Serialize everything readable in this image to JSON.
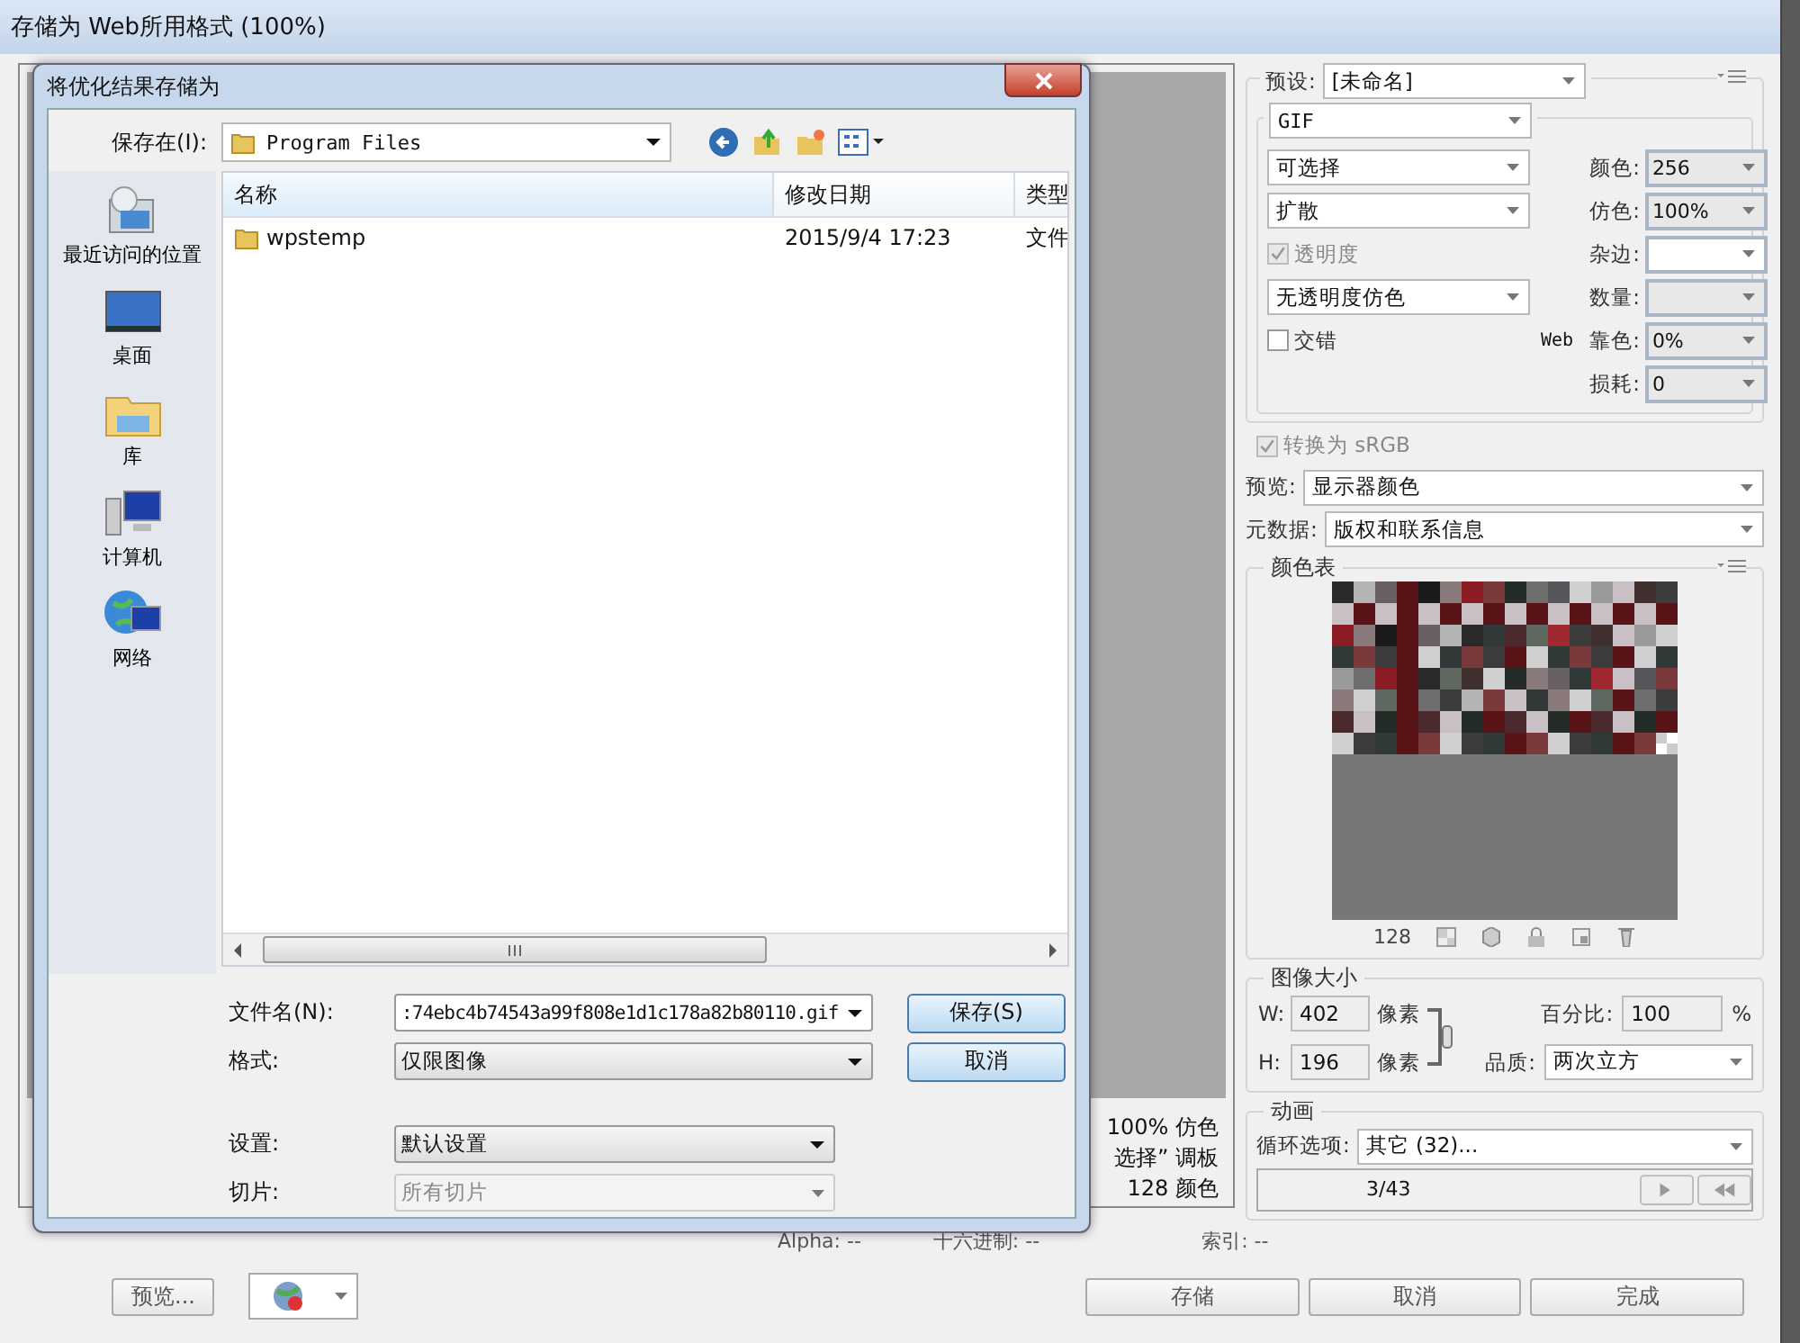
{
  "window": {
    "title": "存储为 Web所用格式 (100%)"
  },
  "preview": {
    "info": [
      "100% 仿色",
      "选择” 调板",
      "128 颜色"
    ]
  },
  "settings_panel": {
    "preset": {
      "label": "预设:",
      "value": "[未命名]"
    },
    "format": "GIF",
    "left_controls": [
      {
        "kind": "dropdown",
        "value": "可选择"
      },
      {
        "kind": "dropdown",
        "value": "扩散"
      },
      {
        "kind": "checkbox",
        "label": "透明度",
        "checked": true,
        "disabled": true
      },
      {
        "kind": "dropdown",
        "value": "无透明度仿色"
      },
      {
        "kind": "checkbox",
        "label": "交错",
        "checked": false,
        "disabled": false
      }
    ],
    "right_fields": [
      {
        "kind": "combo",
        "label": "颜色:",
        "value": "256"
      },
      {
        "kind": "combo",
        "label": "仿色:",
        "value": "100%"
      },
      {
        "kind": "matte",
        "label": "杂边:"
      },
      {
        "kind": "combo",
        "label": "数量:"
      },
      {
        "kind": "combo",
        "prefix": "Web",
        "label": "靠色:",
        "value": "0%"
      },
      {
        "kind": "combo",
        "label": "损耗:",
        "value": "0"
      }
    ],
    "convert_srgb": {
      "label": "转换为 sRGB",
      "checked": true,
      "disabled": true
    },
    "preview_mode": {
      "label": "预览:",
      "value": "显示器颜色"
    },
    "metadata": {
      "label": "元数据:",
      "value": "版权和联系信息"
    }
  },
  "color_table": {
    "title": "颜色表",
    "count": "128"
  },
  "image_size": {
    "title": "图像大小",
    "width": {
      "label": "W:",
      "value": "402",
      "unit": "像素"
    },
    "height": {
      "label": "H:",
      "value": "196",
      "unit": "像素"
    },
    "percent": {
      "label": "百分比:",
      "value": "100",
      "unit": "%"
    },
    "quality": {
      "label": "品质:",
      "value": "两次立方"
    }
  },
  "animation": {
    "title": "动画",
    "loop": {
      "label": "循环选项:",
      "value": "其它 (32)..."
    },
    "frame": "3/43"
  },
  "status_bar": {
    "items": [
      "Alpha: --",
      "十六进制: --",
      "索引: --"
    ]
  },
  "preview_button": "预览...",
  "action_buttons": [
    "存储",
    "取消",
    "完成"
  ],
  "dialog": {
    "title": "将优化结果存储为",
    "save_in": {
      "label": "保存在(I):",
      "value": "Program Files"
    },
    "places": [
      {
        "kind": "recent",
        "label": "最近访问的位置"
      },
      {
        "kind": "desktop",
        "label": "桌面"
      },
      {
        "kind": "library",
        "label": "库"
      },
      {
        "kind": "computer",
        "label": "计算机"
      },
      {
        "kind": "network",
        "label": "网络"
      }
    ],
    "columns": [
      "名称",
      "修改日期",
      "类型"
    ],
    "rows": [
      {
        "cells": [
          "wpstemp",
          "2015/9/4 17:23",
          "文件"
        ]
      }
    ],
    "fields": [
      {
        "kind": "name",
        "label": "文件名(N):",
        "value": ":74ebc4b74543a99f808e1d1c178a82b80110.gif",
        "disabled": false
      },
      {
        "kind": "format",
        "label": "格式:",
        "value": "仅限图像",
        "disabled": false
      },
      {
        "kind": "settings",
        "label": "设置:",
        "value": "默认设置",
        "disabled": false
      },
      {
        "kind": "slices",
        "label": "切片:",
        "value": "所有切片",
        "disabled": true
      }
    ],
    "buttons": [
      "保存(S)",
      "取消"
    ]
  }
}
